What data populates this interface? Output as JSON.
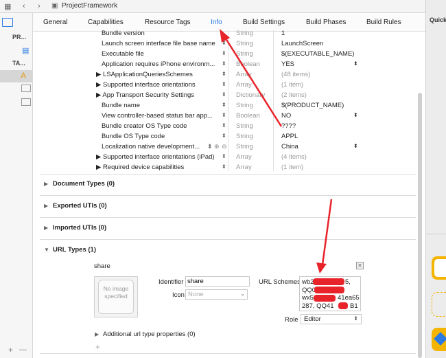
{
  "window": {
    "breadcrumb": "ProjectFramework"
  },
  "left_panel": {
    "labels": [
      "PR...",
      "TA..."
    ]
  },
  "right_panel": {
    "label": "Quick"
  },
  "tabs": [
    {
      "label": "General",
      "active": false
    },
    {
      "label": "Capabilities",
      "active": false
    },
    {
      "label": "Resource Tags",
      "active": false
    },
    {
      "label": "Info",
      "active": true
    },
    {
      "label": "Build Settings",
      "active": false
    },
    {
      "label": "Build Phases",
      "active": false
    },
    {
      "label": "Build Rules",
      "active": false
    }
  ],
  "info_rows": [
    {
      "key": "Bundle version",
      "type": "String",
      "value": "1"
    },
    {
      "key": "Launch screen interface file base name",
      "type": "String",
      "value": "LaunchScreen"
    },
    {
      "key": "Executable file",
      "type": "String",
      "value": "$(EXECUTABLE_NAME)"
    },
    {
      "key": "Application requires iPhone environm...",
      "type": "Boolean",
      "value": "YES"
    },
    {
      "key": "▶ LSApplicationQueriesSchemes",
      "type": "Array",
      "value": "(48 items)"
    },
    {
      "key": "▶ Supported interface orientations",
      "type": "Array",
      "value": "(1 item)"
    },
    {
      "key": "▶ App Transport Security Settings",
      "type": "Dictionary",
      "value": "(2 items)"
    },
    {
      "key": "Bundle name",
      "type": "String",
      "value": "$(PRODUCT_NAME)"
    },
    {
      "key": "View controller-based status bar app...",
      "type": "Boolean",
      "value": "NO"
    },
    {
      "key": "Bundle creator OS Type code",
      "type": "String",
      "value": "????"
    },
    {
      "key": "Bundle OS Type code",
      "type": "String",
      "value": "APPL"
    },
    {
      "key": "Localization native development...",
      "type": "String",
      "value": "China"
    },
    {
      "key": "▶ Supported interface orientations (iPad)",
      "type": "Array",
      "value": "(4 items)"
    },
    {
      "key": "▶ Required device capabilities",
      "type": "Array",
      "value": "(1 item)"
    }
  ],
  "sections": [
    {
      "label": "Document Types (0)"
    },
    {
      "label": "Exported UTIs (0)"
    },
    {
      "label": "Imported UTIs (0)"
    },
    {
      "label": "URL Types (1)"
    }
  ],
  "url_type": {
    "name": "share",
    "no_image_text": "No image specified",
    "identifier_label": "Identifier",
    "identifier_value": "share",
    "icon_label": "Icon",
    "icon_placeholder": "None",
    "url_schemes_label": "URL Schemes",
    "url_schemes_lines": [
      "wb2",
      "QQ0",
      "wx5",
      "287, QQ41"
    ],
    "url_schemes_tails": [
      "5,",
      "",
      "41ea65",
      "B1"
    ],
    "role_label": "Role",
    "role_value": "Editor",
    "additional_label": "Additional url type properties (0)"
  },
  "footer": {
    "plus": "+",
    "minus": "—"
  },
  "colors": {
    "accent": "#2a7ae2",
    "annotation_red": "#e8232a"
  }
}
